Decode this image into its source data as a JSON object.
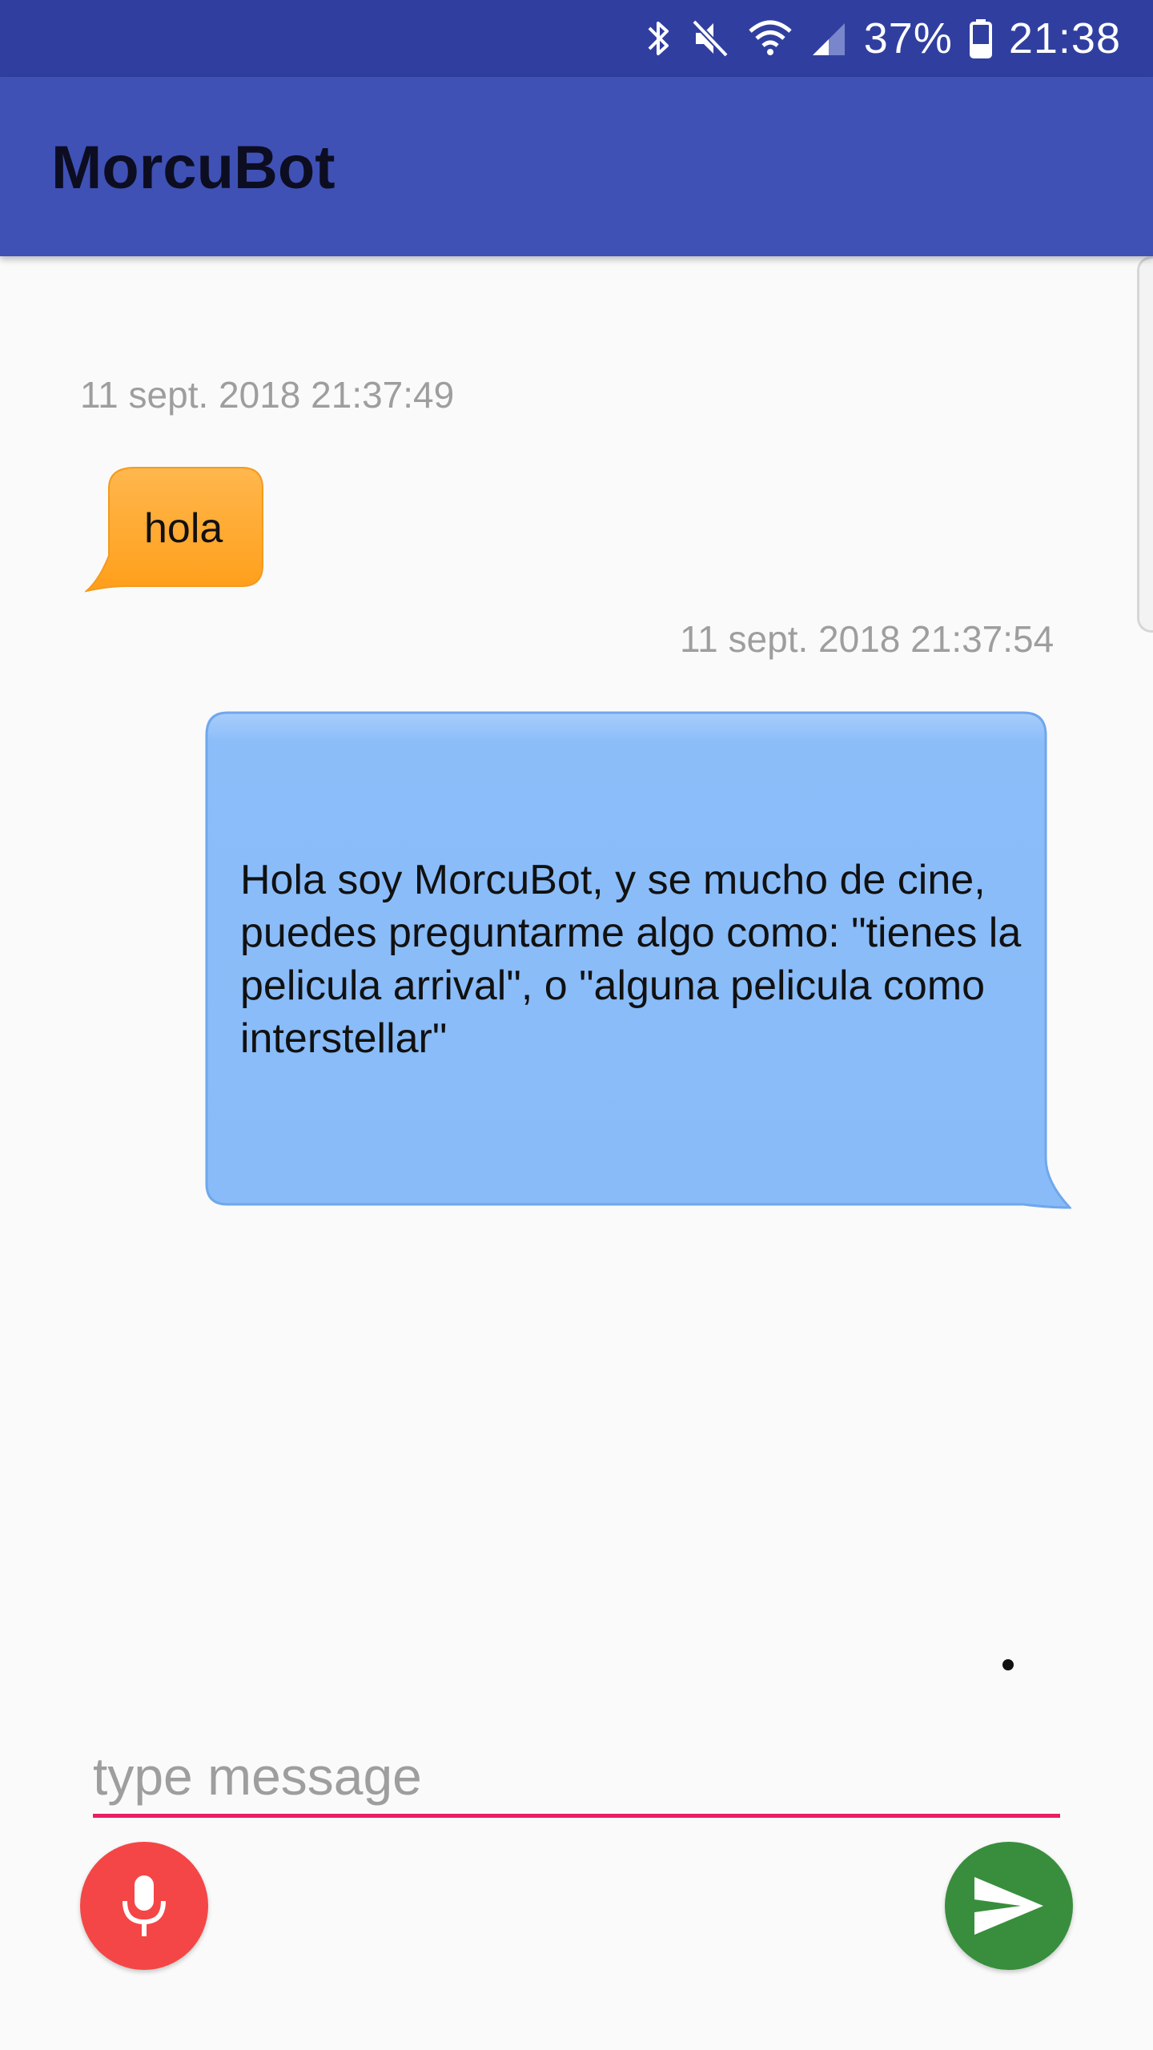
{
  "status_bar": {
    "battery_percent": "37%",
    "time": "21:38",
    "icons": [
      "bluetooth-icon",
      "mute-icon",
      "wifi-icon",
      "signal-icon",
      "battery-icon"
    ]
  },
  "app_bar": {
    "title": "MorcuBot"
  },
  "messages": [
    {
      "timestamp": "11 sept. 2018 21:37:49",
      "text": "hola",
      "sender": "user",
      "bubble_color": "#ffa726"
    },
    {
      "timestamp": "11 sept. 2018 21:37:54",
      "text": "Hola soy MorcuBot, y se mucho de cine, puedes preguntarme algo como: \"tienes la pelicula arrival\", o \"alguna pelicula como interstellar\"",
      "sender": "bot",
      "bubble_color": "#8bbdf9"
    }
  ],
  "composer": {
    "placeholder": "type message",
    "value": "",
    "mic_icon": "microphone-icon",
    "send_icon": "send-icon"
  },
  "colors": {
    "status_bar": "#303f9f",
    "app_bar": "#3f51b5",
    "input_underline": "#e91e63",
    "mic_button": "#f44646",
    "send_button": "#388e3c"
  }
}
